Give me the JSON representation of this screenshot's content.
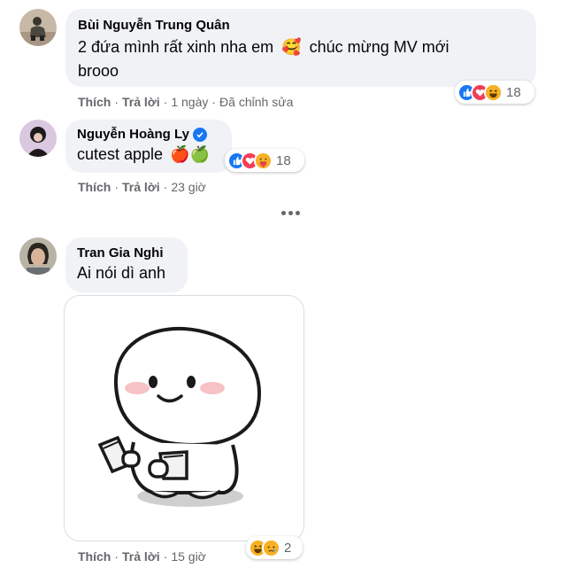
{
  "comments": [
    {
      "author": "Bùi Nguyễn Trung Quân",
      "text_part1": "2 đứa mình rất xinh nha em",
      "emoji1": "🥰",
      "text_part2": "chúc mừng MV mới",
      "text_line2": "brooo",
      "like_label": "Thích",
      "reply_label": "Trả lời",
      "time": "1 ngày",
      "edited": "Đã chỉnh sửa",
      "reaction_icons": [
        "like-icon",
        "love-icon",
        "haha-icon"
      ],
      "reaction_count": "18"
    },
    {
      "author": "Nguyễn Hoàng Ly",
      "verified": true,
      "text": "cutest apple",
      "emojis": "🍎🍏",
      "like_label": "Thích",
      "reply_label": "Trả lời",
      "time": "23 giờ",
      "reaction_icons": [
        "like-icon",
        "love-icon",
        "care-icon"
      ],
      "reaction_count": "18"
    },
    {
      "author": "Tran Gia Nghi",
      "text": "Ai nói dì anh",
      "sticker": "white-blob-character-sticker",
      "like_label": "Thích",
      "reply_label": "Trả lời",
      "time": "15 giờ",
      "reaction_icons": [
        "haha-icon",
        "sad-icon"
      ],
      "reaction_count": "2"
    }
  ],
  "colors": {
    "bubble": "#f0f2f5",
    "meta": "#65676b",
    "like": "#1877f2",
    "love": "#f33e58",
    "haha": "#f7b125"
  }
}
